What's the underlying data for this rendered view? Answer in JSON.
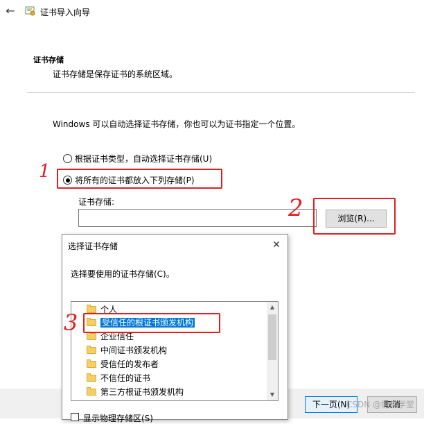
{
  "window": {
    "title": "证书导入向导"
  },
  "section": {
    "title": "证书存储",
    "description": "证书存储是保存证书的系统区域。"
  },
  "intro": "Windows 可以自动选择证书存储，你也可以为证书指定一个位置。",
  "options": [
    {
      "label": "根据证书类型，自动选择证书存储(U)",
      "selected": false
    },
    {
      "label": "将所有的证书都放入下列存储(P)",
      "selected": true
    }
  ],
  "store": {
    "label": "证书存储:",
    "value": ""
  },
  "browse_label": "浏览(R)...",
  "footer": {
    "next_label": "下一页(N)",
    "cancel_label": "取消"
  },
  "watermark": "CSDN @帆软学堂",
  "dialog": {
    "title": "选择证书存储",
    "close_glyph": "✕",
    "prompt": "选择要使用的证书存储(C)。",
    "items": [
      {
        "label": "个人",
        "selected": false
      },
      {
        "label": "受信任的根证书颁发机构",
        "selected": true
      },
      {
        "label": "企业信任",
        "selected": false
      },
      {
        "label": "中间证书颁发机构",
        "selected": false
      },
      {
        "label": "受信任的发布者",
        "selected": false
      },
      {
        "label": "不信任的证书",
        "selected": false
      },
      {
        "label": "第三方根证书颁发机构",
        "selected": false
      }
    ],
    "show_physical_label": "显示物理存储区(S)",
    "show_physical_checked": false
  },
  "annotations": [
    {
      "number": "1"
    },
    {
      "number": "2"
    },
    {
      "number": "3"
    }
  ],
  "colors": {
    "annotation": "#e02020",
    "selection": "#0078d7",
    "folder": "#f5cf62"
  }
}
